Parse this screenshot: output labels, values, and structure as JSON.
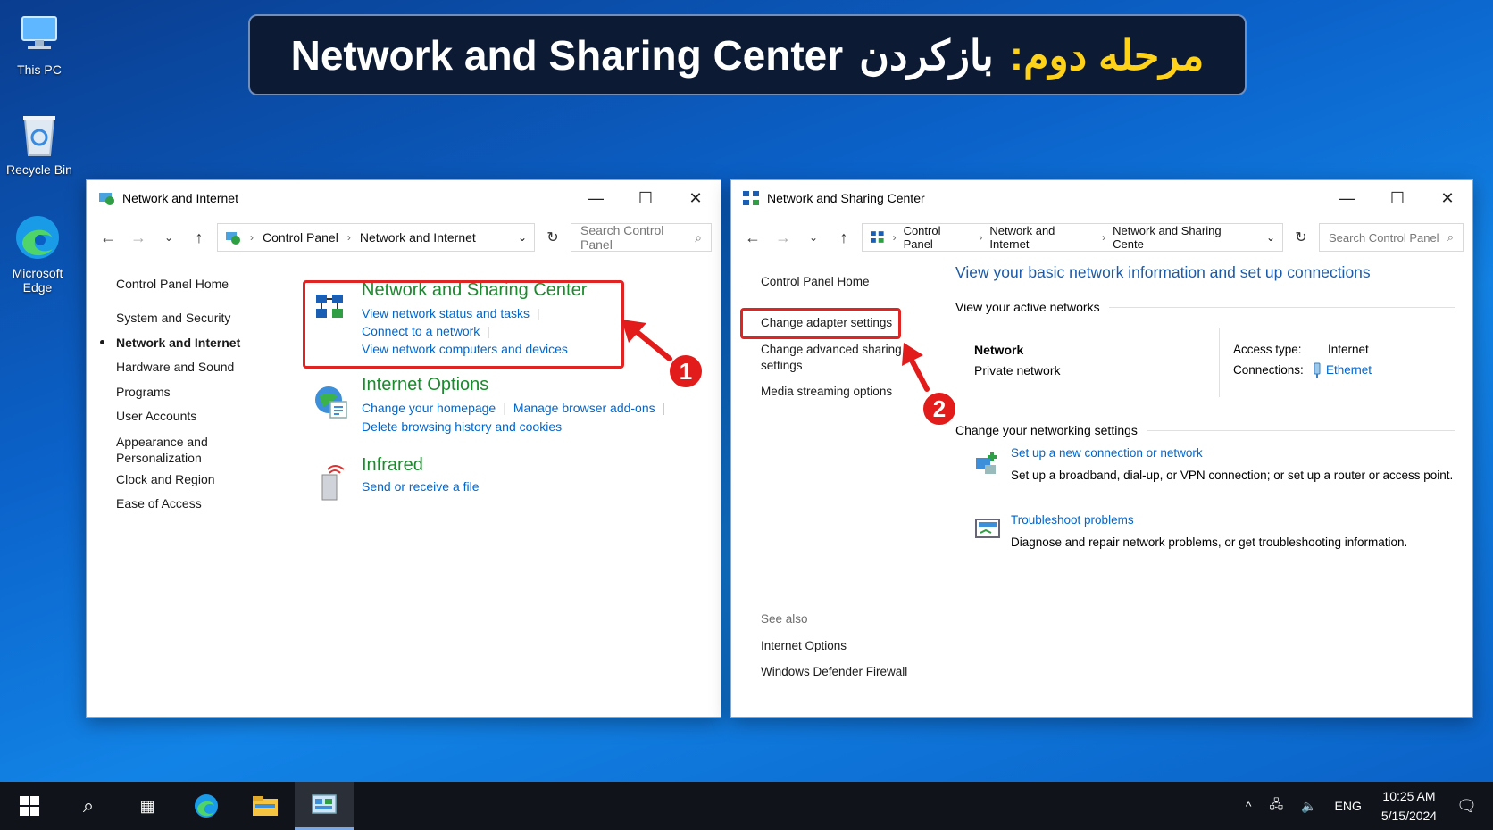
{
  "desktop": {
    "icons": [
      {
        "label": "This PC"
      },
      {
        "label": "Recycle Bin"
      },
      {
        "label": "Microsoft Edge"
      }
    ]
  },
  "banner": {
    "english": "Network and Sharing Center",
    "persian_white": "بازکردن",
    "persian_yellow": "مرحله دوم:"
  },
  "win1": {
    "title": "Network and Internet",
    "breadcrumb": [
      "Control Panel",
      "Network and Internet"
    ],
    "search_placeholder": "Search Control Panel",
    "nav": {
      "home": "Control Panel Home",
      "items": [
        "System and Security",
        "Network and Internet",
        "Hardware and Sound",
        "Programs",
        "User Accounts",
        "Appearance and Personalization",
        "Clock and Region",
        "Ease of Access"
      ]
    },
    "sections": [
      {
        "heading": "Network and Sharing Center",
        "links": [
          "View network status and tasks",
          "Connect to a network",
          "View network computers and devices"
        ]
      },
      {
        "heading": "Internet Options",
        "links": [
          "Change your homepage",
          "Manage browser add-ons",
          "Delete browsing history and cookies"
        ]
      },
      {
        "heading": "Infrared",
        "links": [
          "Send or receive a file"
        ]
      }
    ],
    "step_badge": "1"
  },
  "win2": {
    "title": "Network and Sharing Center",
    "breadcrumb": [
      "Control Panel",
      "Network and Internet",
      "Network and Sharing Cente"
    ],
    "search_placeholder": "Search Control Panel",
    "nav": {
      "home": "Control Panel Home",
      "change_adapter": "Change adapter settings",
      "advanced_sharing": "Change advanced sharing settings",
      "media_streaming": "Media streaming options",
      "see_also": "See also",
      "internet_options": "Internet Options",
      "firewall": "Windows Defender Firewall"
    },
    "main_heading": "View your basic network information and set up connections",
    "active_networks_label": "View your active networks",
    "network_name": "Network",
    "network_type": "Private network",
    "access_type_label": "Access type:",
    "access_type_value": "Internet",
    "connections_label": "Connections:",
    "connections_value": "Ethernet",
    "change_settings_label": "Change your networking settings",
    "tasks": [
      {
        "link": "Set up a new connection or network",
        "desc": "Set up a broadband, dial-up, or VPN connection; or set up a router or access point."
      },
      {
        "link": "Troubleshoot problems",
        "desc": "Diagnose and repair network problems, or get troubleshooting information."
      }
    ],
    "step_badge": "2"
  },
  "taskbar": {
    "language": "ENG",
    "time": "10:25 AM",
    "date": "5/15/2024"
  },
  "colors": {
    "banner_yellow": "#ffd21a",
    "link_blue": "#0066cc",
    "heading_green": "#1b8a2e",
    "highlight_red": "#e02424"
  }
}
